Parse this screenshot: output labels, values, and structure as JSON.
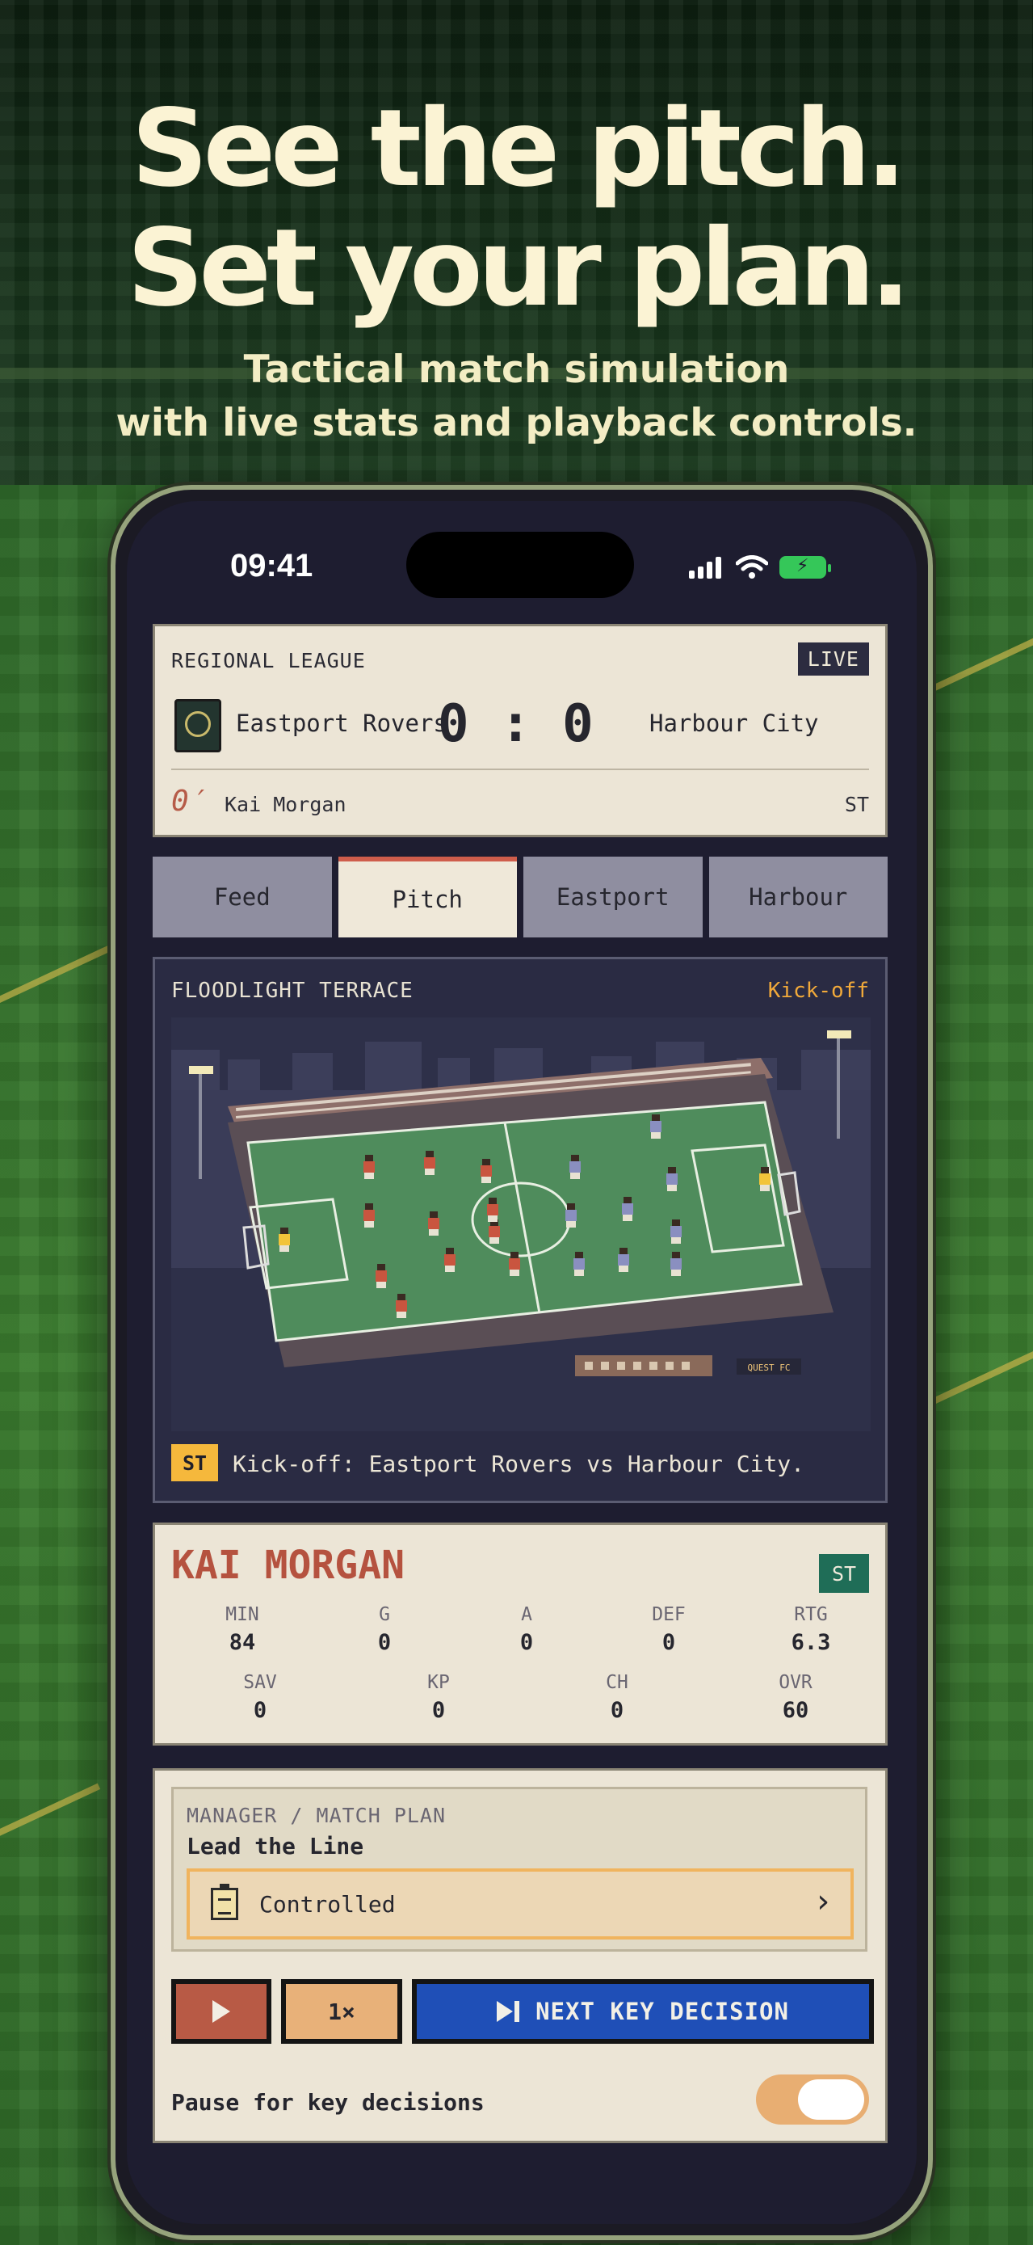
{
  "hero": {
    "headline_line1": "See the pitch.",
    "headline_line2": "Set your plan.",
    "subline_line1": "Tactical match simulation",
    "subline_line2": "with live stats and playback controls."
  },
  "status_bar": {
    "time": "09:41",
    "icons": [
      "signal-icon",
      "wifi-icon",
      "battery-charging-icon"
    ],
    "battery_color": "#35c759"
  },
  "match": {
    "league": "REGIONAL LEAGUE",
    "live_label": "LIVE",
    "home_team": "Eastport Rovers",
    "away_team": "Harbour City",
    "score": "0 : 0",
    "minute": "0′",
    "featured_player": "Kai Morgan",
    "featured_position": "ST"
  },
  "tabs": [
    {
      "label": "Feed",
      "active": false
    },
    {
      "label": "Pitch",
      "active": true
    },
    {
      "label": "Eastport",
      "active": false
    },
    {
      "label": "Harbour",
      "active": false
    }
  ],
  "pitch": {
    "venue": "FLOODLIGHT TERRACE",
    "phase": "Kick-off",
    "sponsor_board": "QUEST FC",
    "event_badge": "ST",
    "event_text": "Kick-off: Eastport Rovers vs Harbour City.",
    "home_color": "#c9553f",
    "away_color": "#8a8fc0",
    "keeper_color": "#f2c43a"
  },
  "player_stats": {
    "name": "KAI MORGAN",
    "position": "ST",
    "row1": [
      {
        "label": "MIN",
        "value": "84"
      },
      {
        "label": "G",
        "value": "0"
      },
      {
        "label": "A",
        "value": "0"
      },
      {
        "label": "DEF",
        "value": "0"
      },
      {
        "label": "RTG",
        "value": "6.3"
      }
    ],
    "row2": [
      {
        "label": "SAV",
        "value": "0"
      },
      {
        "label": "KP",
        "value": "0"
      },
      {
        "label": "CH",
        "value": "0"
      },
      {
        "label": "OVR",
        "value": "60"
      }
    ]
  },
  "manager": {
    "section_label": "MANAGER / MATCH PLAN",
    "plan_name": "Lead the Line",
    "plan_style": "Controlled",
    "speed_label": "1×",
    "next_label": "NEXT KEY DECISION",
    "pause_label": "Pause for key decisions",
    "pause_enabled": true
  },
  "colors": {
    "accent_red": "#cf5d4b",
    "accent_blue": "#1f4fb7",
    "accent_amber": "#f1a93a",
    "card_bg": "#ece5d6"
  }
}
